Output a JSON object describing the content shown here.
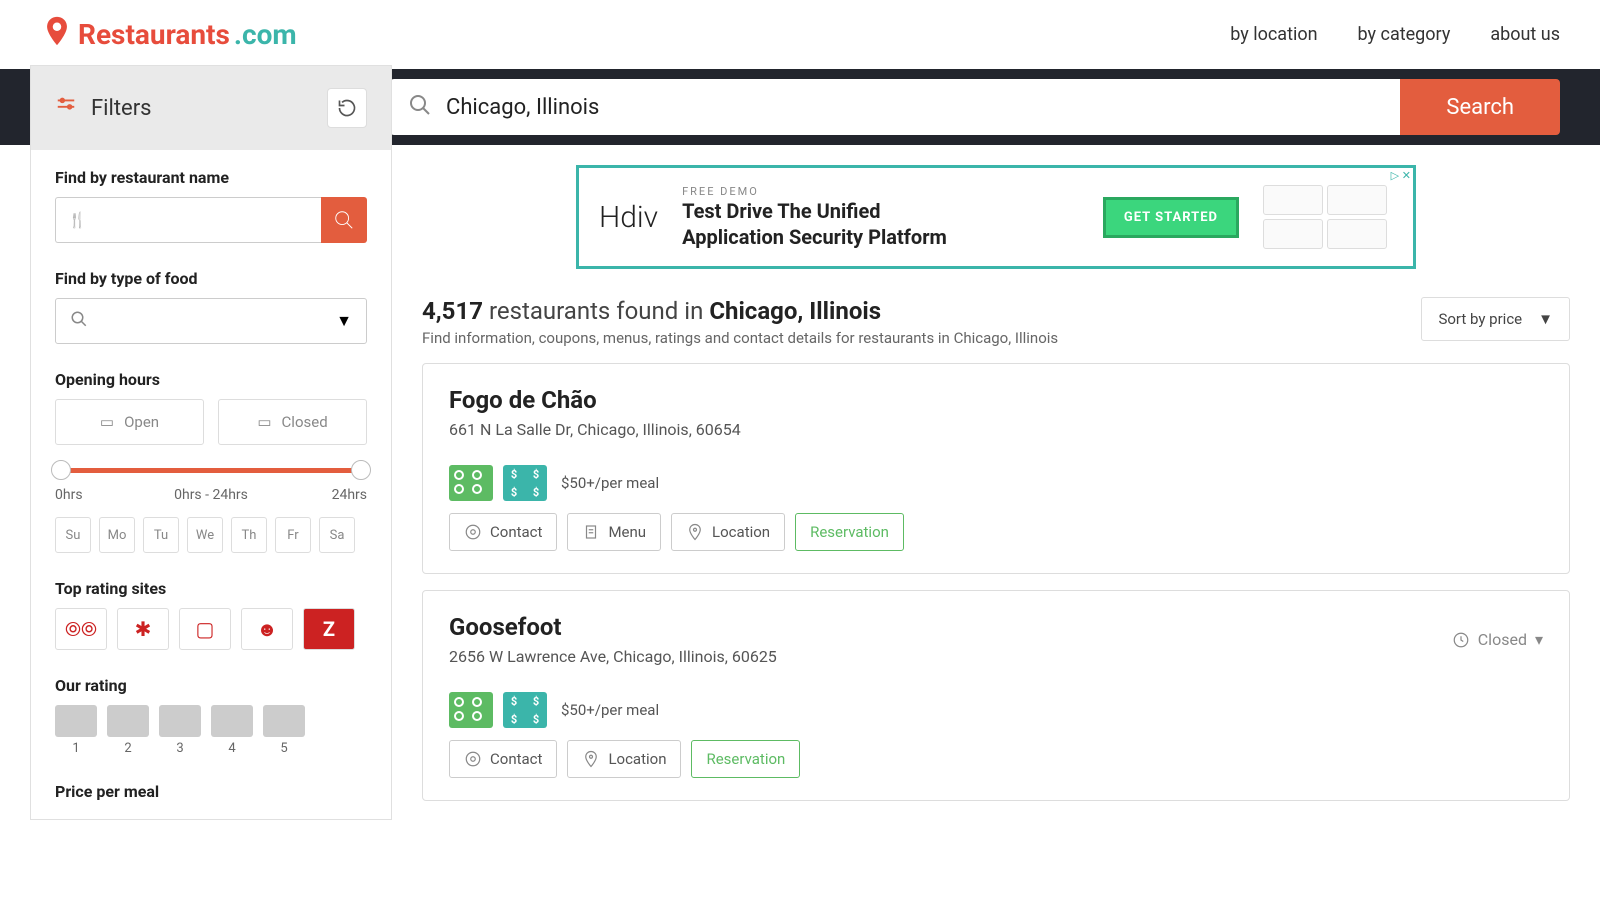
{
  "header": {
    "logo_prefix": "Restaurants",
    "logo_suffix": ".com",
    "nav": [
      "by location",
      "by category",
      "about us"
    ]
  },
  "search": {
    "value": "Chicago, Illinois",
    "button": "Search"
  },
  "filters": {
    "heading": "Filters",
    "name_label": "Find by restaurant name",
    "type_label": "Find by type of food",
    "hours_label": "Opening hours",
    "open_btn": "Open",
    "closed_btn": "Closed",
    "slider_min": "0hrs",
    "slider_max": "24hrs",
    "slider_mid": "0hrs - 24hrs",
    "days": [
      "Su",
      "Mo",
      "Tu",
      "We",
      "Th",
      "Fr",
      "Sa"
    ],
    "sites_label": "Top rating sites",
    "our_label": "Our rating",
    "rating_nums": [
      "1",
      "2",
      "3",
      "4",
      "5"
    ],
    "price_label": "Price per meal"
  },
  "ad": {
    "brand": "Hdiv",
    "demo": "FREE DEMO",
    "line1": "Test Drive The Unified",
    "line2": "Application Security Platform",
    "cta": "GET STARTED"
  },
  "results": {
    "count": "4,517",
    "found_in": " restaurants found in ",
    "location": "Chicago, Illinois",
    "subtitle": "Find information, coupons, menus, ratings and contact details for restaurants in Chicago, Illinois",
    "sort": "Sort by price"
  },
  "cards": [
    {
      "name": "Fogo de Chão",
      "address": "661 N La Salle Dr, Chicago, Illinois, 60654",
      "price": "$50+/per meal",
      "actions": [
        "Contact",
        "Menu",
        "Location",
        "Reservation"
      ],
      "status": ""
    },
    {
      "name": "Goosefoot",
      "address": "2656 W Lawrence Ave, Chicago, Illinois, 60625",
      "price": "$50+/per meal",
      "actions": [
        "Contact",
        "Location",
        "Reservation"
      ],
      "status": "Closed"
    }
  ]
}
